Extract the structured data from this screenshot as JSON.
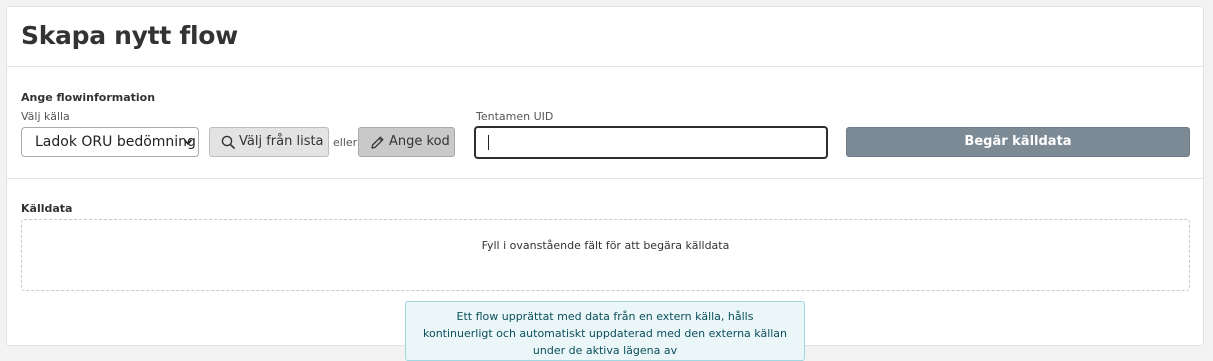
{
  "page": {
    "title": "Skapa nytt flow"
  },
  "flowinfo": {
    "section_label": "Ange flowinformation",
    "source_label": "Välj källa",
    "source_selected": "Ladok ORU bedömning",
    "choose_list_label": "Välj från lista",
    "or_label": "eller",
    "enter_code_label": "Ange kod",
    "uid_label": "Tentamen UID",
    "uid_value": "",
    "request_button_label": "Begär källdata"
  },
  "source_data": {
    "section_label": "Källdata",
    "empty_message": "Fyll i ovanstående fält för att begära källdata"
  },
  "info": {
    "text": "Ett flow upprättat med data från en extern källa, hålls kontinuerligt och automatiskt uppdaterad med den externa källan under de aktiva lägena av"
  },
  "colors": {
    "request_button": "#7c8a96",
    "info_box_bg": "#eaf6f8",
    "info_box_border": "#9fd6df"
  },
  "icons": {
    "search": "search-icon",
    "pencil": "pencil-icon",
    "dropdown": "chevron-down-icon"
  }
}
